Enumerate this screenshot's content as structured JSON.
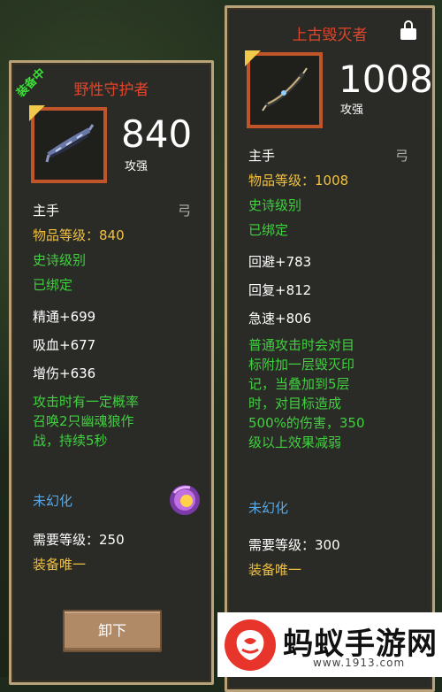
{
  "left_card": {
    "equipped_badge": "装备中",
    "title": "野性守护者",
    "power": "840",
    "power_label": "攻强",
    "slot": "主手",
    "weapon_type": "弓",
    "item_level": "物品等级：840",
    "rarity": "史诗级别",
    "bound": "已绑定",
    "stats": [
      "精通+699",
      "吸血+677",
      "增伤+636"
    ],
    "effect_lines": [
      "攻击时有一定概率",
      "召唤2只幽魂狼作",
      "战，持续5秒"
    ],
    "transmog": "未幻化",
    "required_level": "需要等级：250",
    "unique": "装备唯一",
    "unequip_button": "卸下"
  },
  "right_card": {
    "title": "上古毁灭者",
    "power": "1008",
    "power_label": "攻强",
    "slot": "主手",
    "weapon_type": "弓",
    "item_level": "物品等级：1008",
    "rarity": "史诗级别",
    "bound": "已绑定",
    "stats": [
      "回避+783",
      "回复+812",
      "急速+806"
    ],
    "effect_lines": [
      "普通攻击时会对目",
      "标附加一层毁灭印",
      "记，当叠加到5层",
      "时，对目标造成",
      "500%的伤害，350",
      "级以上效果减弱"
    ],
    "transmog": "未幻化",
    "required_level": "需要等级：300",
    "unique": "装备唯一"
  },
  "watermark": {
    "brand": "蚂蚁手游网",
    "url": "www.1913.com"
  },
  "colors": {
    "title_red": "#e0462c",
    "gold": "#f0c040",
    "green": "#40d040",
    "blue": "#5aa8e6",
    "frame_orange": "#c0552a"
  }
}
